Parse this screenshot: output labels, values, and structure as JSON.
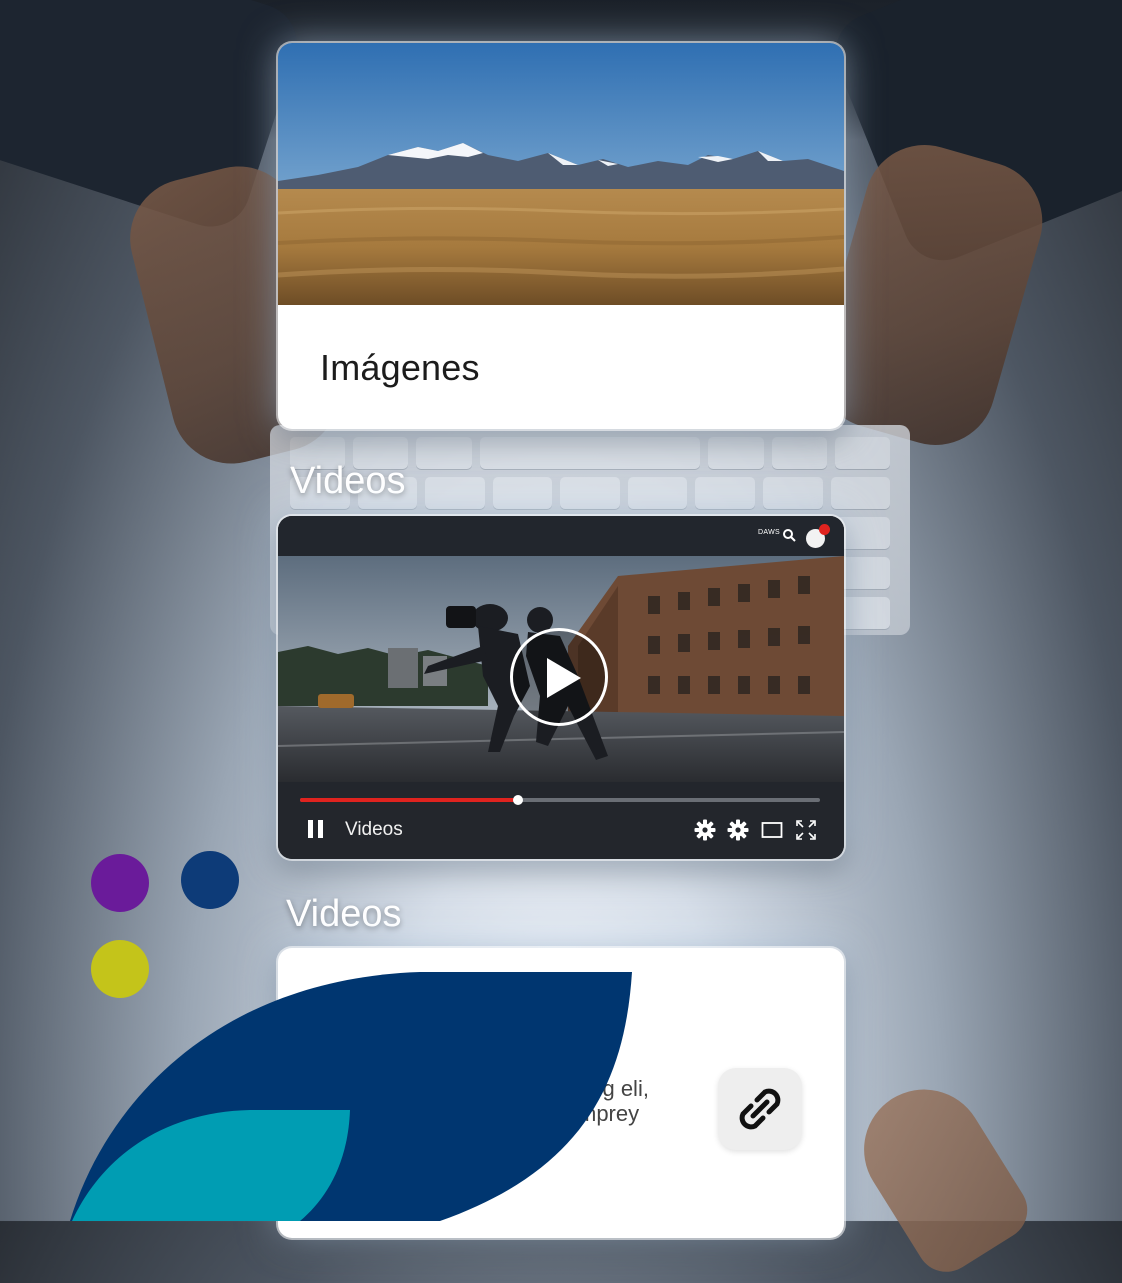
{
  "cards": {
    "images": {
      "label": "Imágenes"
    },
    "video_section_heading": "Videos",
    "video_player": {
      "topbar_text": "DAWS",
      "label": "Videos",
      "progress": 0.42
    },
    "second_section_heading": "Videos",
    "link_card": {
      "text_line1": "ang eli,",
      "text_line2": "mprey"
    }
  },
  "icons": {
    "pause": "pause-icon",
    "play": "play-icon",
    "settings": "gear-icon",
    "quality": "gear-icon",
    "theater": "theater-mode-icon",
    "fullscreen": "fullscreen-icon",
    "search": "search-icon",
    "link": "link-icon"
  },
  "colors": {
    "progress_red": "#e0231f",
    "brand_purple": "#6a1b9a",
    "brand_blue": "#0d3b78",
    "brand_yellow": "#c4c41a",
    "brand_navy": "#003670",
    "brand_teal": "#009db3"
  }
}
